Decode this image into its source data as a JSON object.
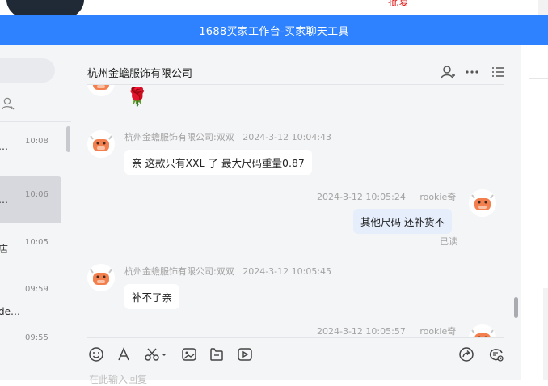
{
  "window": {
    "title": "1688买家工作台-买家聊天工具"
  },
  "background": {
    "red_text": "批复"
  },
  "sidebar": {
    "conversations": [
      {
        "name": "…",
        "time": "10:08",
        "active": false
      },
      {
        "name": "…",
        "time": "10:06",
        "active": true
      },
      {
        "name": "店",
        "time": "10:05",
        "active": false
      },
      {
        "name": "",
        "time": "09:59",
        "active": false
      },
      {
        "name": "de…",
        "time": "",
        "active": false
      },
      {
        "name": "",
        "time": "09:55",
        "active": false
      }
    ]
  },
  "chat": {
    "title": "杭州金蟾服饰有限公司",
    "messages": [
      {
        "side": "left",
        "sender": "",
        "time": "",
        "emoji": "🌹"
      },
      {
        "side": "left",
        "sender": "杭州金蟾服饰有限公司:双双",
        "time": "2024-3-12 10:04:43",
        "text": "亲 这款只有XXL 了  最大尺码重量0.87"
      },
      {
        "side": "right",
        "sender": "rookie奇",
        "time": "2024-3-12 10:05:24",
        "text": "其他尺码 还补货不",
        "status": "已读"
      },
      {
        "side": "left",
        "sender": "杭州金蟾服饰有限公司:双双",
        "time": "2024-3-12 10:05:45",
        "text": "补不了亲"
      },
      {
        "side": "right",
        "sender": "rookie奇",
        "time": "2024-3-12 10:05:57",
        "text": ""
      }
    ],
    "input_placeholder": "在此输入回复"
  },
  "colors": {
    "titlebar": "#2f82ff",
    "mine_bubble": "#e6eefc",
    "avatar_face": "#f47f4e"
  },
  "icons": [
    "user-icon",
    "more-icon",
    "list-icon",
    "emoji-icon",
    "font-icon",
    "scissors-icon",
    "image-icon",
    "file-icon",
    "video-icon",
    "share-icon",
    "history-icon"
  ]
}
